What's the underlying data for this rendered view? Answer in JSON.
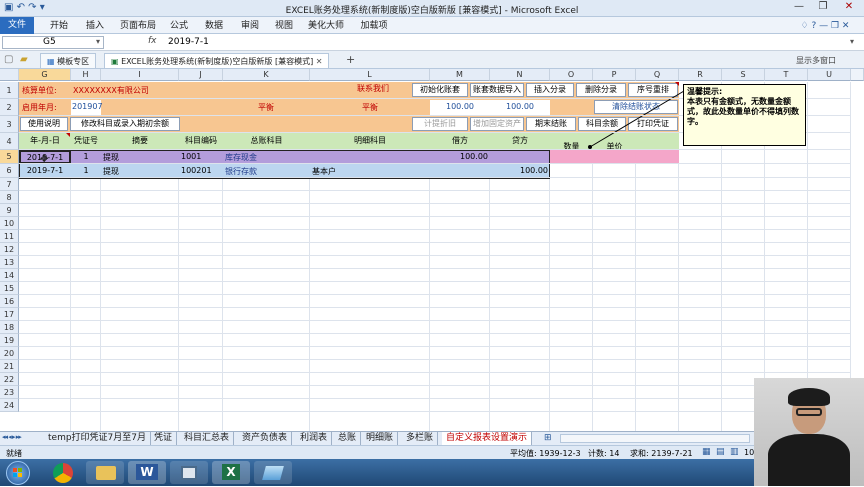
{
  "window": {
    "title": "EXCEL账务处理系统(新制度版)空白版新版  [兼容模式]  -  Microsoft Excel",
    "qat": "▣ ↶ ↷ ▾",
    "min": "—",
    "max": "❐",
    "close": "✕"
  },
  "ribbon": {
    "file": "文件",
    "tabs": [
      "开始",
      "插入",
      "页面布局",
      "公式",
      "数据",
      "审阅",
      "视图",
      "美化大师",
      "加载项"
    ],
    "right_icons": "♢ ? — ❐ ✕"
  },
  "formula_bar": {
    "name_box": "G5",
    "fx": "fx",
    "value": "2019-7-1"
  },
  "doc_tabs": {
    "items": [
      "模板专区",
      "EXCEL账务处理系统(新制度版)空白版新版  [兼容模式]"
    ],
    "add": "+",
    "multi_window": "显示多窗口"
  },
  "columns": [
    "G",
    "H",
    "I",
    "J",
    "K",
    "L",
    "M",
    "N",
    "O",
    "P",
    "Q",
    "R",
    "S",
    "T",
    "U"
  ],
  "rows": [
    "1",
    "2",
    "3",
    "4",
    "5",
    "6",
    "7",
    "8",
    "9",
    "10",
    "11",
    "12",
    "13",
    "14",
    "15",
    "16",
    "17",
    "18",
    "19",
    "20",
    "21",
    "22",
    "23",
    "24"
  ],
  "sheet": {
    "r1": {
      "label": "核算单位:",
      "unit": "XXXXXXXX有限公司",
      "btn_contact": "联系我们",
      "btn_init": "初始化账套",
      "btn_import": "账套数据导入",
      "btn_insert": "插入分录",
      "btn_delete": "删除分录",
      "btn_renum": "序号重排"
    },
    "r2": {
      "label": "启用年月:",
      "value": "201907",
      "balance1": "平衡",
      "balance2": "平衡",
      "m": "100.00",
      "n": "100.00",
      "btn_clear": "清除结账状态"
    },
    "r3": {
      "btn_help": "使用说明",
      "btn_modify": "修改科目或录入期初余额",
      "btn_depr": "计提折旧",
      "btn_asset": "增加固定资产",
      "btn_close": "期末结账",
      "btn_balance": "科目余额",
      "btn_print": "打印凭证"
    },
    "r4": {
      "date": "年-月-日",
      "voucher": "凭证号",
      "summary": "摘要",
      "code": "科目编码",
      "account": "总账科目",
      "detail": "明细科目",
      "debit": "借方",
      "credit": "贷方",
      "qty": "数量",
      "price": "单价"
    },
    "entries": [
      {
        "date": "2019-7-1",
        "no": "1",
        "summary": "提现",
        "code": "1001",
        "account": "库存现金",
        "detail": "",
        "debit": "100.00",
        "credit": ""
      },
      {
        "date": "2019-7-1",
        "no": "1",
        "summary": "提现",
        "code": "100201",
        "account": "银行存款",
        "detail": "基本户",
        "debit": "",
        "credit": "100.00"
      }
    ]
  },
  "comment": {
    "title": "温馨提示:",
    "body": "本表只有金额式，无数量金额式，故此处数量单价不得填列数字。"
  },
  "sheet_tabs": {
    "nav": "◂◂ ◂ ▸ ▸▸",
    "items": [
      "temp打印凭证7月至7月",
      "凭证",
      "科目汇总表",
      "资产负债表",
      "利润表",
      "总账",
      "明细账",
      "多栏账",
      "自定义报表设置演示"
    ],
    "active_index": 8
  },
  "status": {
    "ready": "就绪",
    "average": "平均值: 1939-12-3",
    "count": "计数: 14",
    "sum": "求和: 2139-7-21",
    "zoom": "10"
  },
  "taskbar": {
    "apps": [
      "start",
      "chrome",
      "explorer",
      "word",
      "app",
      "excel",
      "tool"
    ],
    "word_glyph": "W",
    "excel_glyph": "X"
  }
}
